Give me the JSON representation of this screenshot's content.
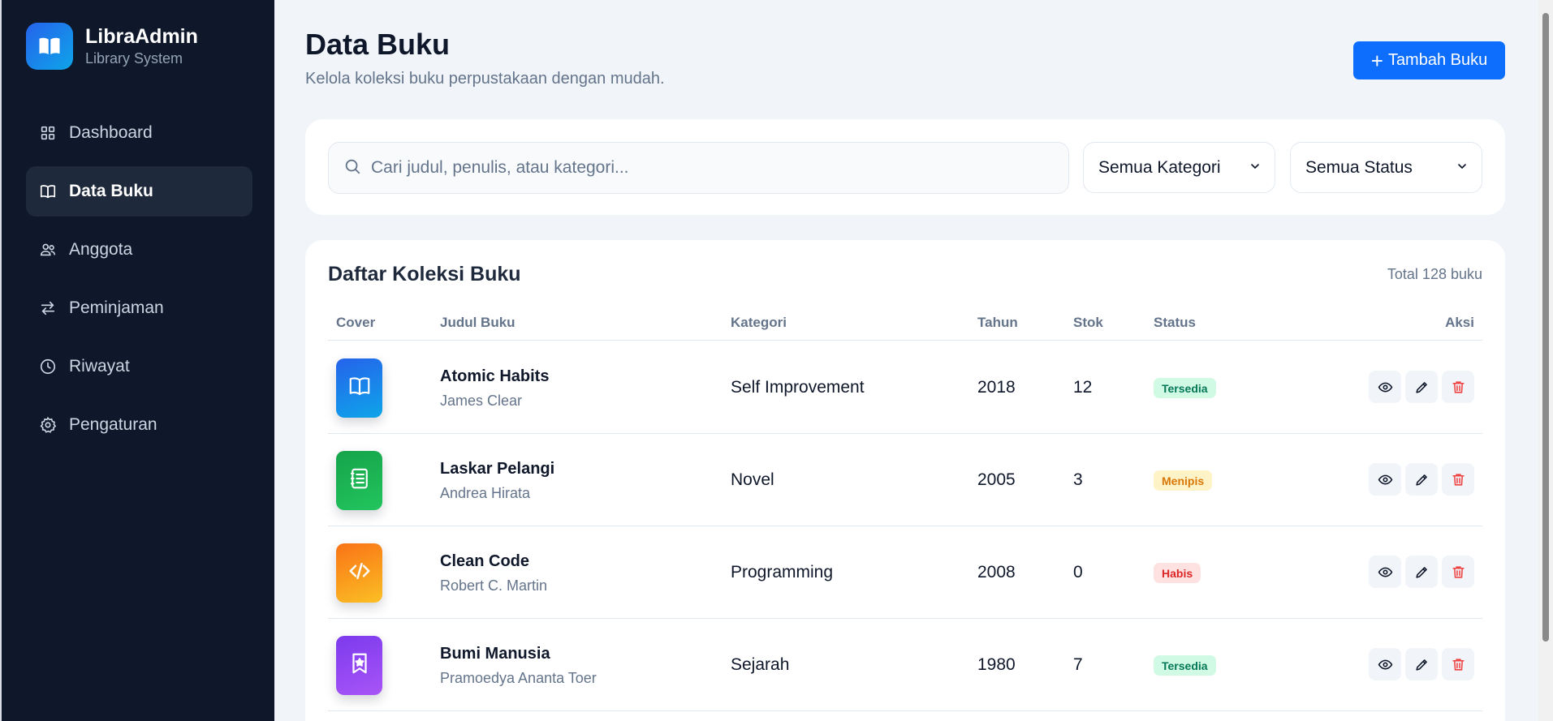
{
  "brand": {
    "title": "LibraAdmin",
    "subtitle": "Library System",
    "icon": "open-book-icon"
  },
  "sidebar": {
    "items": [
      {
        "label": "Dashboard",
        "icon": "grid-icon",
        "active": false
      },
      {
        "label": "Data Buku",
        "icon": "book-icon",
        "active": true
      },
      {
        "label": "Anggota",
        "icon": "users-icon",
        "active": false
      },
      {
        "label": "Peminjaman",
        "icon": "swap-arrows-icon",
        "active": false
      },
      {
        "label": "Riwayat",
        "icon": "clock-icon",
        "active": false
      },
      {
        "label": "Pengaturan",
        "icon": "gear-icon",
        "active": false
      }
    ]
  },
  "header": {
    "title": "Data Buku",
    "subtitle": "Kelola koleksi buku perpustakaan dengan mudah.",
    "add_button_icon": "+",
    "add_button_label": "Tambah Buku"
  },
  "filters": {
    "search_placeholder": "Cari judul, penulis, atau kategori...",
    "category_value": "Semua Kategori",
    "status_value": "Semua Status"
  },
  "table": {
    "title": "Daftar Koleksi Buku",
    "total": "Total 128 buku",
    "columns": [
      "Cover",
      "Judul Buku",
      "Kategori",
      "Tahun",
      "Stok",
      "Status",
      "Aksi"
    ],
    "rows": [
      {
        "title": "Atomic Habits",
        "author": "James Clear",
        "category": "Self Improvement",
        "year": "2018",
        "stock": "12",
        "status": "Tersedia",
        "status_type": "ok",
        "cover_color": "#0ea5e9",
        "cover_icon": "open-book-icon"
      },
      {
        "title": "Laskar Pelangi",
        "author": "Andrea Hirata",
        "category": "Novel",
        "year": "2005",
        "stock": "3",
        "status": "Menipis",
        "status_type": "low",
        "cover_color": "#22c55e",
        "cover_icon": "notebook-icon"
      },
      {
        "title": "Clean Code",
        "author": "Robert C. Martin",
        "category": "Programming",
        "year": "2008",
        "stock": "0",
        "status": "Habis",
        "status_type": "out",
        "cover_color": "#f97316",
        "cover_icon": "code-icon"
      },
      {
        "title": "Bumi Manusia",
        "author": "Pramoedya Ananta Toer",
        "category": "Sejarah",
        "year": "1980",
        "stock": "7",
        "status": "Tersedia",
        "status_type": "ok",
        "cover_color": "#8b5cf6",
        "cover_icon": "bookmark-star-icon"
      }
    ]
  },
  "colors": {
    "primary": "#0d6efd",
    "sidebar_bg": "#0f172a",
    "page_bg": "#f1f5f9"
  }
}
